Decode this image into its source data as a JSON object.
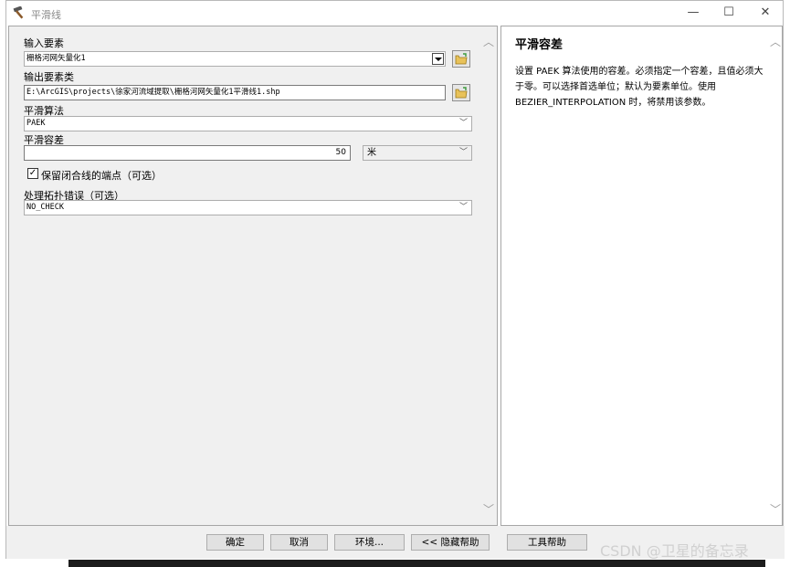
{
  "window": {
    "title": "平滑线",
    "icon": "hammer-icon",
    "controls": {
      "minimize": "—",
      "maximize": "☐",
      "close": "✕"
    }
  },
  "form": {
    "input_features": {
      "label": "输入要素",
      "value": "栅格河网矢量化1"
    },
    "output_feature_class": {
      "label": "输出要素类",
      "value": "E:\\ArcGIS\\projects\\徐家河流域提取\\栅格河网矢量化1平滑线1.shp"
    },
    "smoothing_algorithm": {
      "label": "平滑算法",
      "value": "PAEK"
    },
    "smoothing_tolerance": {
      "label": "平滑容差",
      "value": "50",
      "unit": "米"
    },
    "preserve_endpoints": {
      "label": "保留闭合线的端点（可选）",
      "checked": true,
      "check_glyph": "✓"
    },
    "topology_errors": {
      "label": "处理拓扑错误（可选）",
      "value": "NO_CHECK"
    },
    "scroll": {
      "up": "︿",
      "down": "﹀"
    }
  },
  "help": {
    "title": "平滑容差",
    "text": "设置 PAEK 算法使用的容差。必须指定一个容差，且值必须大于零。可以选择首选单位；默认为要素单位。使用 BEZIER_INTERPOLATION 时，将禁用该参数。"
  },
  "buttons": {
    "ok": "确定",
    "cancel": "取消",
    "environments": "环境...",
    "hide_help": "<< 隐藏帮助",
    "tool_help": "工具帮助"
  },
  "watermark": "CSDN @卫星的备忘录",
  "colors": {
    "panel_bg": "#f0f0f0",
    "button_bg": "#e1e1e1",
    "border": "#a6a6a6",
    "folder_yellow": "#e8c25a",
    "folder_green": "#3a9a3a"
  }
}
